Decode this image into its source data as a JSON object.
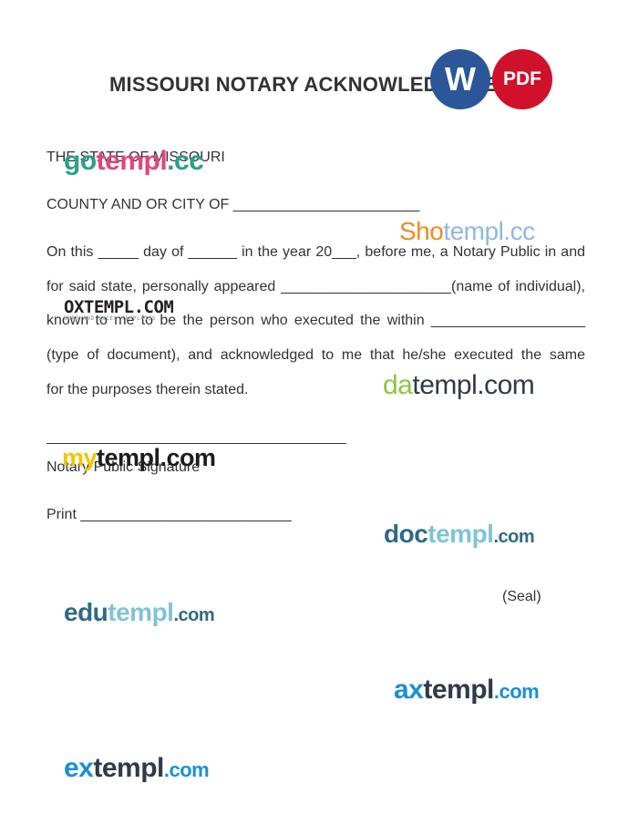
{
  "document": {
    "title": "MISSOURI NOTARY ACKNOWLEDGEMENT",
    "state_line": "THE STATE OF MISSOURI",
    "county_line": "COUNTY AND OR CITY OF _______________________",
    "paragraph_lines": [
      "On this _____ day of ______ in the year 20___, before me, a  Notary Public in and",
      "for said state, personally appeared _____________________(name of individual),",
      "known to me to be the person  who  executed  the  within ___________________",
      "(type  of  document),  and  acknowledged  to  me  that he/she executed the same",
      "for the purposes therein stated."
    ],
    "signature_label": "Notary Public Signature",
    "print_line": "Print  __________________________",
    "seal_label": "(Seal)"
  },
  "badges": {
    "word": "W",
    "pdf": "PDF"
  },
  "watermarks": {
    "gotempl": {
      "part1": "go",
      "part2": "templ",
      "part3": ".cc"
    },
    "shotempl": {
      "part1": "Sho",
      "part2": "templ.cc"
    },
    "oxtempl": {
      "main": "OXTEMPL.COM",
      "sub": "WORD AND EXCEL TEMPLATES"
    },
    "datempl": {
      "part1": "da",
      "part2": "templ.com"
    },
    "mytempl": {
      "part1": "my",
      "part2": "templ.com"
    },
    "doctempl": {
      "part1": "doc",
      "part2": "templ",
      "part3": ".com"
    },
    "edutempl": {
      "part1": "edu",
      "part2": "templ",
      "part3": ".com"
    },
    "axtempl": {
      "part1": "ax",
      "part2": "templ",
      "part3": ".com"
    },
    "extempl": {
      "part1": "ex",
      "part2": "templ",
      "part3": ".com"
    }
  },
  "colors": {
    "text": "#333333",
    "word_blue": "#2b579a",
    "pdf_red": "#d0112b"
  }
}
